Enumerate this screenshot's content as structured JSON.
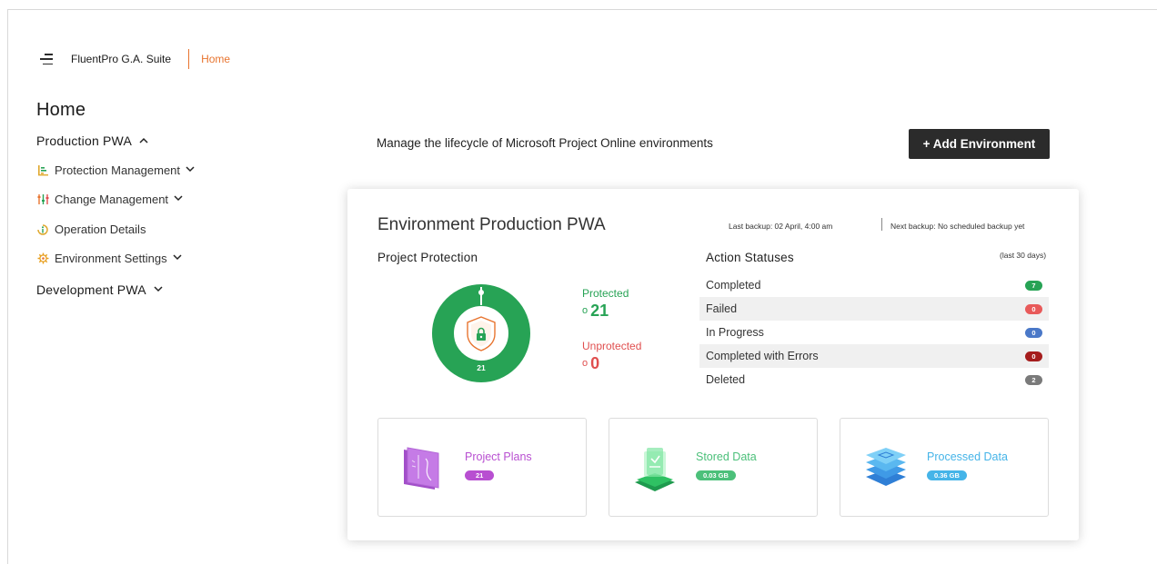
{
  "app": {
    "title": "FluentPro G.A. Suite",
    "breadcrumb": "Home"
  },
  "page": {
    "title": "Home"
  },
  "sidebar": {
    "production": {
      "label": "Production PWA",
      "expanded": true
    },
    "items": [
      {
        "label": "Protection Management",
        "icon": "bar-chart-icon",
        "has_chevron": true
      },
      {
        "label": "Change Management",
        "icon": "sliders-icon",
        "has_chevron": true
      },
      {
        "label": "Operation Details",
        "icon": "info-icon",
        "has_chevron": false
      },
      {
        "label": "Environment Settings",
        "icon": "gear-icon",
        "has_chevron": true
      }
    ],
    "development": {
      "label": "Development PWA",
      "expanded": false
    }
  },
  "header": {
    "description": "Manage the lifecycle of Microsoft Project Online environments",
    "add_button": "+ Add Environment"
  },
  "environment": {
    "title": "Environment Production PWA",
    "last_backup": "Last backup: 02 April, 4:00 am",
    "next_backup": "Next backup: No scheduled backup yet"
  },
  "protection": {
    "heading": "Project Protection",
    "total": "21",
    "protected_label": "Protected",
    "protected_value": "21",
    "unprotected_label": "Unprotected",
    "unprotected_value": "0",
    "colors": {
      "protected": "#27a355",
      "unprotected": "#e04f4f"
    }
  },
  "actions": {
    "heading": "Action Statuses",
    "period": "(last 30 days)",
    "rows": [
      {
        "label": "Completed",
        "count": "7",
        "color": "#27a355"
      },
      {
        "label": "Failed",
        "count": "0",
        "color": "#e85a5a"
      },
      {
        "label": "In Progress",
        "count": "0",
        "color": "#4a78c8"
      },
      {
        "label": "Completed with Errors",
        "count": "0",
        "color": "#a51d1d"
      },
      {
        "label": "Deleted",
        "count": "2",
        "color": "#7a7a7a"
      }
    ]
  },
  "tiles": [
    {
      "label": "Project Plans",
      "value": "21",
      "color": "#b84fd1",
      "icon": "project-plans-icon"
    },
    {
      "label": "Stored Data",
      "value": "0.03 GB",
      "color": "#4cc07a",
      "icon": "stored-data-icon"
    },
    {
      "label": "Processed Data",
      "value": "0.36 GB",
      "color": "#45b4e8",
      "icon": "processed-data-icon"
    }
  ]
}
